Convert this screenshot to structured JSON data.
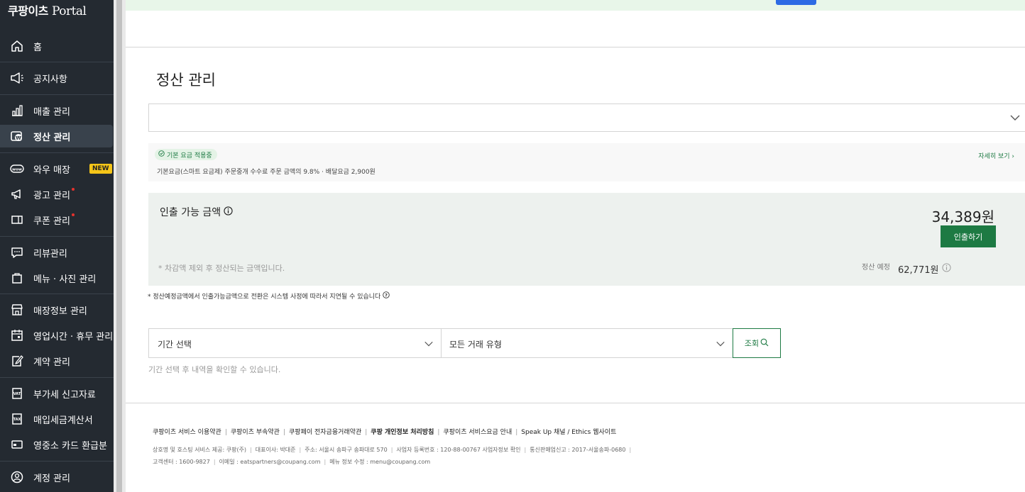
{
  "app": {
    "logo_prefix": "쿠팡이츠",
    "logo_suffix": "Portal"
  },
  "sidebar": {
    "items": [
      {
        "label": "홈",
        "icon": "home-icon"
      },
      {
        "label": "공지사항",
        "icon": "megaphone-icon"
      },
      {
        "label": "매출 관리",
        "icon": "bar-chart-icon"
      },
      {
        "label": "정산 관리",
        "icon": "settlement-icon",
        "active": true
      },
      {
        "label": "와우 매장",
        "icon": "wow-icon",
        "badge": "NEW"
      },
      {
        "label": "광고 관리",
        "icon": "ad-megaphone-icon",
        "dot": true
      },
      {
        "label": "쿠폰 관리",
        "icon": "coupon-icon",
        "dot": true
      },
      {
        "label": "리뷰관리",
        "icon": "review-icon"
      },
      {
        "label": "메뉴 · 사진 관리",
        "icon": "menu-bag-icon"
      },
      {
        "label": "매장정보 관리",
        "icon": "store-icon"
      },
      {
        "label": "영업시간 · 휴무 관리",
        "icon": "calendar-icon"
      },
      {
        "label": "계약 관리",
        "icon": "contract-icon"
      },
      {
        "label": "부가세 신고자료",
        "icon": "vat-icon"
      },
      {
        "label": "매입세금계산서",
        "icon": "tax-invoice-icon"
      },
      {
        "label": "영중소 카드 환급분",
        "icon": "card-icon"
      },
      {
        "label": "계정 관리",
        "icon": "account-icon"
      }
    ]
  },
  "page": {
    "title": "정산 관리",
    "plan_tag": "기본 요금 적용중",
    "plan_desc": "기본요금(스마트 요금제)  주문중개 수수료 주문 금액의 9.8% · 배달요금 2,900원",
    "plan_link": "자세히 보기 ›",
    "withdraw": {
      "label": "인출 가능 금액",
      "amount": "34,389원",
      "button": "인출하기",
      "note": "* 차감액 제외 후 정산되는 금액입니다.",
      "scheduled_label": "정산 예정",
      "scheduled_amount": "62,771원"
    },
    "notice": "* 정산예정금액에서 인출가능금액으로 전환은 시스템 사정에 따라서 지연될 수 있습니다",
    "filters": {
      "period": "기간 선택",
      "type": "모든 거래 유형",
      "query_button": "조회"
    },
    "hint": "기간 선택 후 내역을 확인할 수 있습니다."
  },
  "footer": {
    "links": [
      "쿠팡이츠 서비스 이용약관",
      "쿠팡이츠 부속약관",
      "쿠팡페이 전자금융거래약관",
      "쿠팡 개인정보 처리방침",
      "쿠팡이츠 서비스요금 안내",
      "Speak Up 채널 / Ethics 웹사이트"
    ],
    "info_line1": [
      "상호명 및 호스팅 서비스 제공: 쿠팡(주)",
      "대표이사: 박대준",
      "주소: 서울시 송파구 송파대로 570",
      "사업자 등록번호 : 120-88-00767 사업자정보 확인",
      "통신판매업신고 : 2017-서울송파-0680"
    ],
    "info_line2": [
      "고객센터 : 1600-9827",
      "이메일 : eatspartners@coupang.com",
      "메뉴 정보 수정 : menu@coupang.com"
    ]
  },
  "colors": {
    "sidebar_bg": "#242a31",
    "accent_green": "#1d7a43",
    "badge_yellow": "#f5c518"
  }
}
